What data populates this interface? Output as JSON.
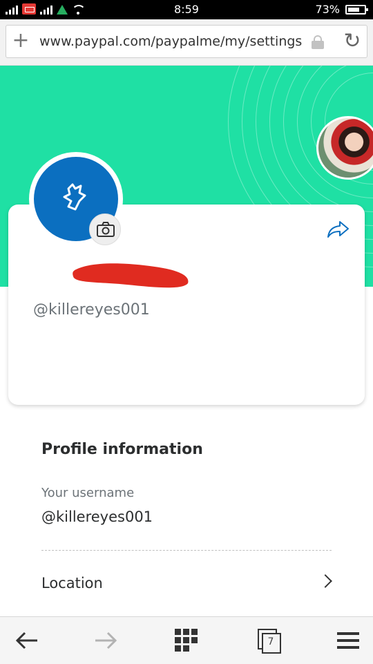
{
  "status_bar": {
    "time": "8:59",
    "battery_percent": "73%",
    "icons": [
      "signal-icon",
      "notification-icon",
      "signal-icon",
      "drive-icon",
      "wifi-icon",
      "battery-icon"
    ]
  },
  "browser": {
    "url": "www.paypal.com/paypalme/my/settings",
    "icons": [
      "plus-icon",
      "lock-icon",
      "reload-icon"
    ]
  },
  "profile_card": {
    "handle": "@killereyes001",
    "avatar_color": "#0b6fc0",
    "icons": [
      "camera-icon",
      "share-icon"
    ]
  },
  "theme": {
    "hero_color": "#1fe0a4"
  },
  "profile_information": {
    "title": "Profile information",
    "username_label": "Your username",
    "username_value": "@killereyes001",
    "location_label": "Location"
  },
  "bottom_nav": {
    "tab_count": "7",
    "icons": [
      "back-arrow-icon",
      "forward-arrow-icon",
      "apps-grid-icon",
      "tabs-icon",
      "menu-icon"
    ]
  }
}
